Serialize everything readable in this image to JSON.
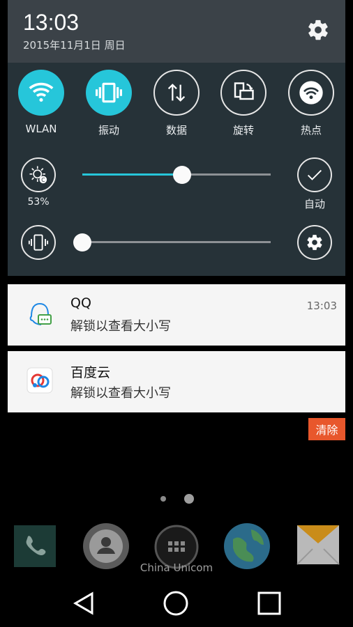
{
  "status": {
    "time": "13:03",
    "date": "2015年11月1日 周日"
  },
  "tiles": [
    {
      "label": "WLAN",
      "icon": "wifi-icon",
      "on": true
    },
    {
      "label": "振动",
      "icon": "vibrate-icon",
      "on": true
    },
    {
      "label": "数据",
      "icon": "data-arrows-icon",
      "on": false
    },
    {
      "label": "旋转",
      "icon": "rotate-icon",
      "on": false
    },
    {
      "label": "热点",
      "icon": "hotspot-icon",
      "on": false
    }
  ],
  "brightness": {
    "value_label": "53%",
    "level": 0.53,
    "auto_label": "自动"
  },
  "volume": {
    "level": 0.0
  },
  "notifications": [
    {
      "app": "QQ",
      "text": "解锁以查看大小写",
      "time": "13:03",
      "icon": "qq-icon"
    },
    {
      "app": "百度云",
      "text": "解锁以查看大小写",
      "time": "",
      "icon": "baidu-cloud-icon"
    }
  ],
  "clear_label": "清除",
  "carrier": "China Unicom",
  "colors": {
    "accent": "#26c6da",
    "panel": "#263238",
    "header": "#3b4248",
    "clear": "#e8572c"
  }
}
